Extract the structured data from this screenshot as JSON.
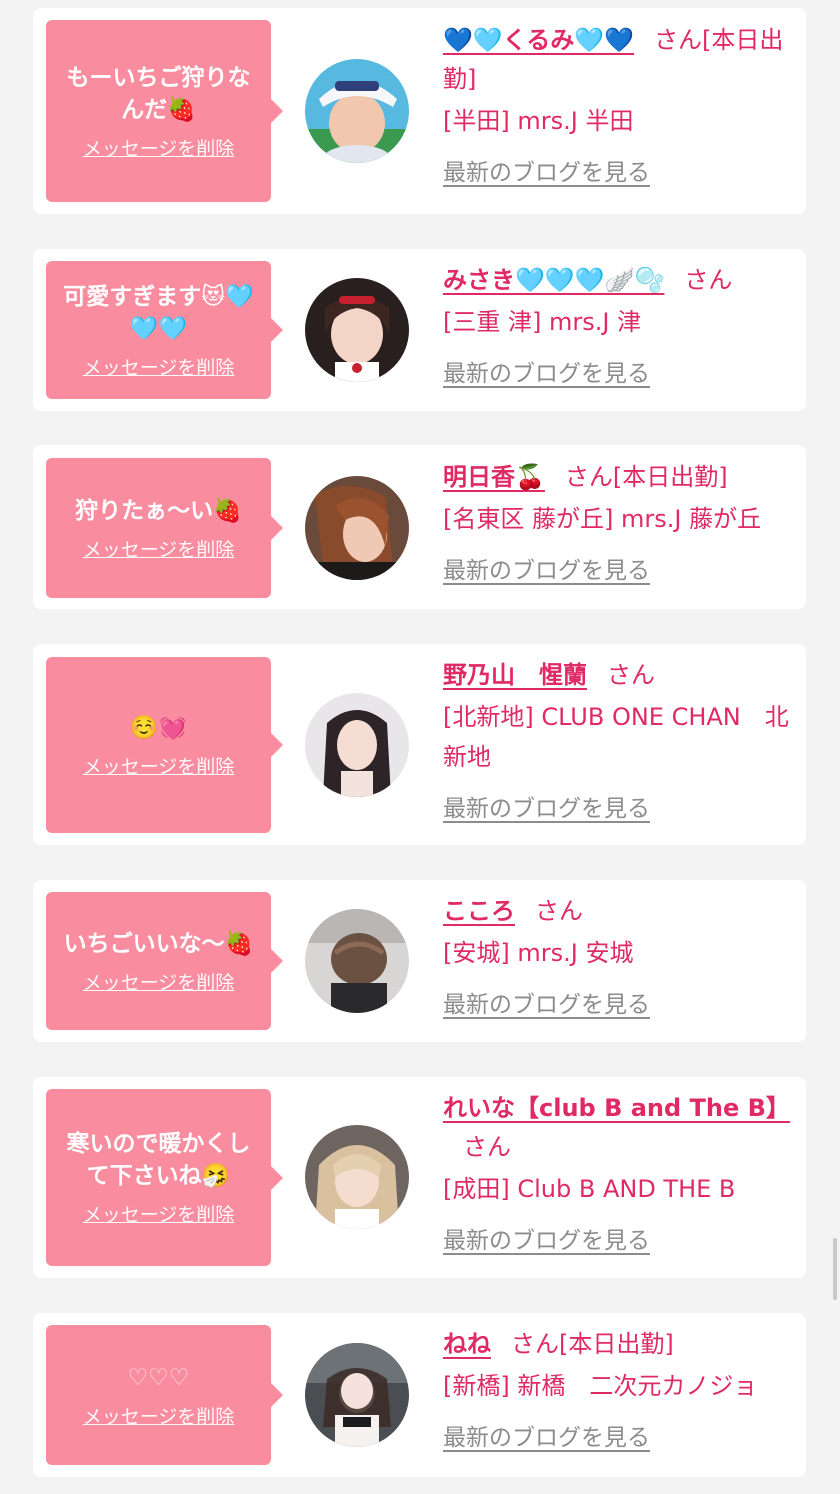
{
  "blog_link_label": "最新のブログを見る",
  "delete_label": "メッセージを削除",
  "messages": [
    {
      "message": "もーいちご狩りなんだ🍓",
      "name": "💙🩵くるみ🩵💙",
      "name_suffix": "さん[本日出勤]",
      "shop": "[半田] mrs.J 半田"
    },
    {
      "message": "可愛すぎます😻🩵🩵🩵",
      "name": "みさき🩵🩵🩵🪽🫧",
      "name_suffix": "さん",
      "shop": "[三重 津] mrs.J 津"
    },
    {
      "message": "狩りたぁ〜い🍓",
      "name": "明日香🍒",
      "name_suffix": "さん[本日出勤]",
      "shop": "[名東区 藤が丘] mrs.J 藤が丘"
    },
    {
      "message": "☺️💓",
      "name": "野乃山　惺蘭",
      "name_suffix": "さん",
      "shop": "[北新地] CLUB ONE CHAN　北新地"
    },
    {
      "message": "いちごいいな〜🍓",
      "name": "こころ",
      "name_suffix": "さん",
      "shop": "[安城] mrs.J 安城"
    },
    {
      "message": "寒いので暖かくして下さいね🤧",
      "name": "れいな【club B and The B】",
      "name_suffix": "さん",
      "shop": "[成田] Club B AND THE B"
    },
    {
      "message": "♡♡♡",
      "name": "ねね",
      "name_suffix": "さん[本日出勤]",
      "shop": "[新橋] 新橋　二次元カノジョ"
    }
  ],
  "colors": {
    "bubble": "#f98d9f",
    "accent": "#e02a63",
    "link_gray": "#8c8c8c",
    "background": "#f3f3f4"
  }
}
